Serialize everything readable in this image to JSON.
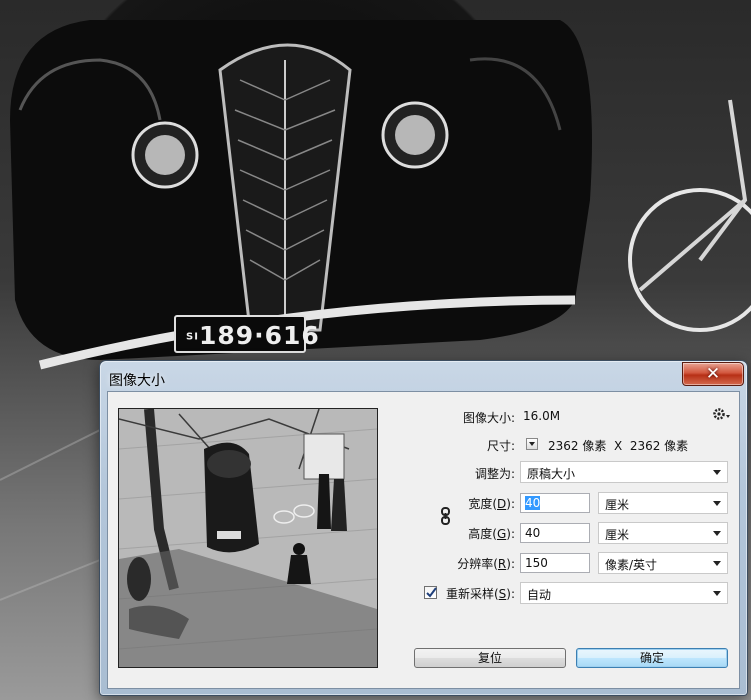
{
  "dialog": {
    "title": "图像大小",
    "close_glyph": "✕"
  },
  "info": {
    "image_size_label": "图像大小:",
    "image_size_value": "16.0M",
    "dimensions_label": "尺寸:",
    "dimensions_value": "2362 像素  X  2362 像素"
  },
  "fit_to": {
    "label": "调整为:",
    "value": "原稿大小"
  },
  "width": {
    "label_prefix": "宽度(",
    "label_key": "D",
    "label_suffix": "):",
    "value": "40",
    "unit": "厘米"
  },
  "height": {
    "label_prefix": "高度(",
    "label_key": "G",
    "label_suffix": "):",
    "value": "40",
    "unit": "厘米"
  },
  "resolution": {
    "label_prefix": "分辨率(",
    "label_key": "R",
    "label_suffix": "):",
    "value": "150",
    "unit": "像素/英寸"
  },
  "resample": {
    "checked": true,
    "label_prefix": "重新采样(",
    "label_key": "S",
    "label_suffix": "):",
    "value": "自动"
  },
  "buttons": {
    "reset": "复位",
    "ok": "确定"
  },
  "background_photo": {
    "license_plate": "189·616",
    "plate_prefix": "SI"
  },
  "icons": {
    "settings": "gear-icon",
    "link": "chain-link-icon",
    "close": "close-icon"
  },
  "colors": {
    "title_gradient_top": "#c9d7e6",
    "close_red": "#c7432a",
    "selection_blue": "#3399ff"
  }
}
